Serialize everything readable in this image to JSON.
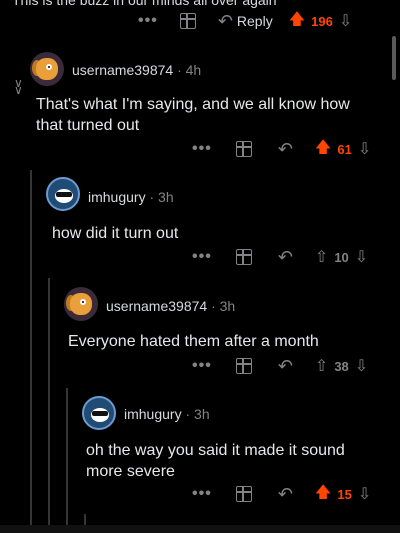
{
  "top": {
    "cut_text": "This is the buzz in our minds all over again",
    "more": "•••",
    "reply_label": "Reply",
    "score": "196"
  },
  "comments": [
    {
      "username": "username39874",
      "age": "4h",
      "body": "That's what I'm saying, and we all know how that turned out",
      "score": "61",
      "upvoted": true
    },
    {
      "username": "imhugury",
      "age": "3h",
      "body": "how did it turn out",
      "score": "10",
      "upvoted": false
    },
    {
      "username": "username39874",
      "age": "3h",
      "body": "Everyone hated them after a month",
      "score": "38",
      "upvoted": false
    },
    {
      "username": "imhugury",
      "age": "3h",
      "body": "oh the way you said it made it sound more severe",
      "score": "15",
      "upvoted": true
    }
  ],
  "icons": {
    "more": "more-options-icon",
    "award": "award-icon",
    "reply": "reply-arrow-icon",
    "upvote": "upvote-icon",
    "downvote": "downvote-icon"
  },
  "colors": {
    "background": "#000000",
    "upvote_active": "#ff4500",
    "muted": "#818384",
    "text": "#d7dadc"
  }
}
